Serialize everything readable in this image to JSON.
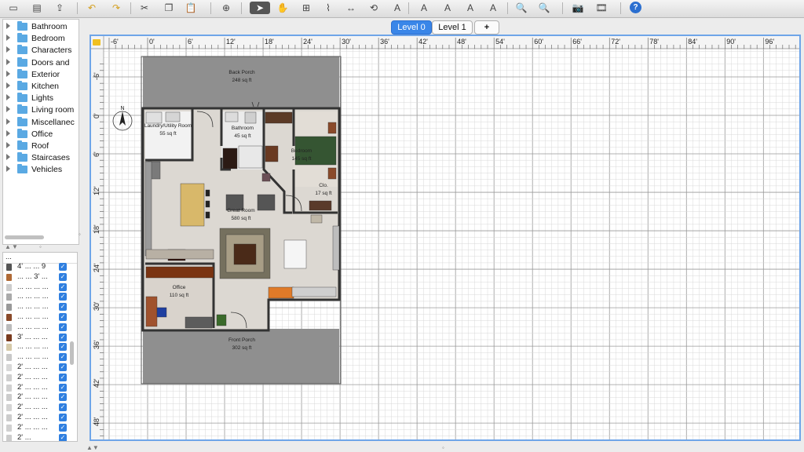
{
  "toolbar": {
    "icons": [
      "new-file-icon",
      "open-file-icon",
      "save-file-icon",
      "undo-icon",
      "redo-icon",
      "cut-icon",
      "copy-icon",
      "paste-icon",
      "add-furniture-icon",
      "select-arrow-icon",
      "pan-hand-icon",
      "create-room-icon",
      "create-polyline-icon",
      "create-dimension-icon",
      "rotate-icon",
      "add-text-icon",
      "text-bold-icon",
      "text-italic-icon",
      "text-increase-icon",
      "text-decrease-icon",
      "zoom-in-icon",
      "zoom-out-icon",
      "create-photo-icon",
      "create-video-icon",
      "help-icon"
    ]
  },
  "catalog": {
    "categories": [
      "Bathroom",
      "Bedroom",
      "Characters",
      "Doors and",
      "Exterior",
      "Kitchen",
      "Lights",
      "Living room",
      "Miscellanec",
      "Office",
      "Roof",
      "Staircases",
      "Vehicles"
    ]
  },
  "furniture": {
    "header": "... ",
    "rows": [
      {
        "text": "4' ... ... 9",
        "color": "#555555"
      },
      {
        "text": "... ... 3' ...",
        "color": "#b06a36"
      },
      {
        "text": "... ... ... ...",
        "color": "#cccccc"
      },
      {
        "text": "... ... ... ...",
        "color": "#aaaaaa"
      },
      {
        "text": "... ... ... ...",
        "color": "#999999"
      },
      {
        "text": "... ... ... ...",
        "color": "#8a4a2a"
      },
      {
        "text": "... ... ... ...",
        "color": "#bbbbbb"
      },
      {
        "text": "3' ... ... ...",
        "color": "#7a3b1e"
      },
      {
        "text": "... ... ... ...",
        "color": "#d5c9a8"
      },
      {
        "text": "... ... ... ...",
        "color": "#c8c8c8"
      },
      {
        "text": "2' ... ... ...",
        "color": "#d8d8d8"
      },
      {
        "text": "2' ... ... ...",
        "color": "#cfcfcf"
      },
      {
        "text": "2' ... ... ...",
        "color": "#d0d0d0"
      },
      {
        "text": "2' ... ... ...",
        "color": "#cccccc"
      },
      {
        "text": "2' ... ... ...",
        "color": "#d4d4d4"
      },
      {
        "text": "2' ... ... ...",
        "color": "#cccccc"
      },
      {
        "text": "2' ... ... ...",
        "color": "#d0d0d0"
      },
      {
        "text": "2' ...",
        "color": "#cccccc"
      }
    ]
  },
  "levels": {
    "tabs": [
      "Level 0",
      "Level 1"
    ],
    "selected": "Level 0",
    "add_label": "+"
  },
  "ruler": {
    "top_labels": [
      "-6'",
      "0'",
      "6'",
      "12'",
      "18'",
      "24'",
      "30'",
      "36'",
      "42'",
      "48'",
      "54'",
      "60'",
      "66'",
      "72'",
      "78'",
      "84'",
      "90'",
      "96'"
    ],
    "left_labels": [
      "-6'",
      "0'",
      "6'",
      "12'",
      "18'",
      "24'",
      "30'",
      "36'",
      "42'",
      "48'"
    ]
  },
  "rooms": [
    {
      "name": "Back Porch",
      "area": "248 sq ft"
    },
    {
      "name": "Laundry/Utility Room",
      "area": "55 sq ft"
    },
    {
      "name": "Bathroom",
      "area": "45 sq ft"
    },
    {
      "name": "Bedroom",
      "area": "145 sq ft"
    },
    {
      "name": "Clo.",
      "area": "17 sq ft"
    },
    {
      "name": "Great Room",
      "area": "580 sq ft"
    },
    {
      "name": "Office",
      "area": "110 sq ft"
    },
    {
      "name": "Front Porch",
      "area": "302 sq ft"
    }
  ],
  "compass_label": "N",
  "colors": {
    "accent": "#3a86e8",
    "floor": "#dcd8d2",
    "porch": "#8f8f8f",
    "wall": "#333333"
  }
}
